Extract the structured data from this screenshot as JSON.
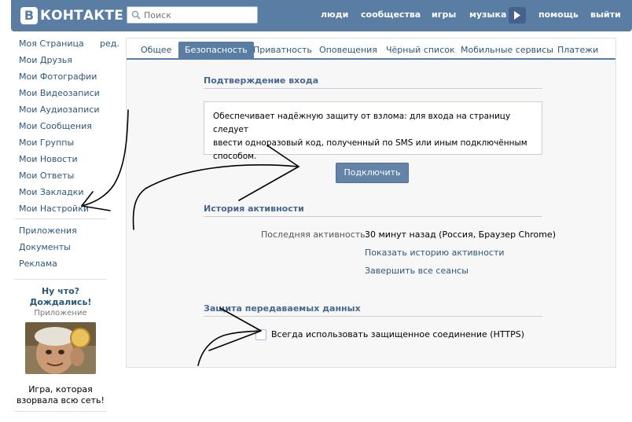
{
  "header": {
    "logo_letter": "B",
    "logo_text": "КОНТАКТЕ",
    "search_placeholder": "Поиск",
    "nav": [
      {
        "label": "люди"
      },
      {
        "label": "сообщества"
      },
      {
        "label": "игры"
      },
      {
        "label": "музыка"
      },
      {
        "label": "помощь"
      },
      {
        "label": "выйти"
      }
    ],
    "brand_color": "#597da3"
  },
  "sidebar": {
    "edit_label": "ред.",
    "items": [
      {
        "label": "Моя Страница"
      },
      {
        "label": "Мои Друзья"
      },
      {
        "label": "Мои Фотографии"
      },
      {
        "label": "Мои Видеозаписи"
      },
      {
        "label": "Мои Аудиозаписи"
      },
      {
        "label": "Мои Сообщения"
      },
      {
        "label": "Мои Группы"
      },
      {
        "label": "Мои Новости"
      },
      {
        "label": "Мои Ответы"
      },
      {
        "label": "Мои Закладки"
      },
      {
        "label": "Мои Настройки"
      }
    ],
    "extra_items": [
      {
        "label": "Приложения"
      },
      {
        "label": "Документы"
      },
      {
        "label": "Реклама"
      }
    ],
    "promo": {
      "title_line1": "Ну что?",
      "title_line2": "Дождались!",
      "subtitle": "Приложение",
      "image_icon": "caveman-app-image",
      "caption_line1": "Игра, которая",
      "caption_line2": "взорвала всю сеть!"
    }
  },
  "tabs": [
    {
      "label": "Общее",
      "active": false
    },
    {
      "label": "Безопасность",
      "active": true
    },
    {
      "label": "Приватность",
      "active": false
    },
    {
      "label": "Оповещения",
      "active": false
    },
    {
      "label": "Чёрный список",
      "active": false
    },
    {
      "label": "Мобильные сервисы",
      "active": false
    },
    {
      "label": "Платежи",
      "active": false
    }
  ],
  "login_confirm": {
    "title": "Подтверждение входа",
    "text_lines": [
      "Обеспечивает надёжную защиту от взлома: для входа на страницу следует",
      "ввести одноразовый код, полученный по SMS или иным подключённым",
      "способом."
    ],
    "button_label": "Подключить"
  },
  "activity": {
    "title": "История активности",
    "last_label": "Последняя активность:",
    "last_value": "30 минут назад (Россия, Браузер Chrome)",
    "show_history_link": "Показать историю активности",
    "end_sessions_link": "Завершить все сеансы"
  },
  "data_protection": {
    "title": "Защита передаваемых данных",
    "https_label": "Всегда использовать защищенное соединение (HTTPS)",
    "https_checked": false
  }
}
